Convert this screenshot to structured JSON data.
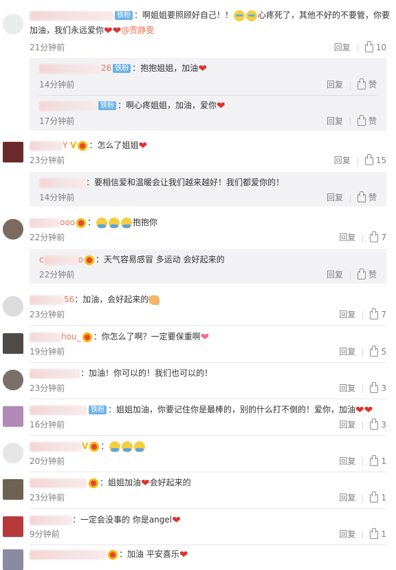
{
  "labels": {
    "reply": "回复",
    "like": "赞",
    "separator": "："
  },
  "comments": [
    {
      "badge": "铁粉",
      "text_a": "啊姐姐要照顾好自己！！",
      "text_b": "心疼死了，其他不好的不要管，你要",
      "text_line2": "加油，我们永远爱你",
      "mention": "@贾静雯",
      "time": "21分钟前",
      "likes": "10",
      "replies": [
        {
          "name_suffix": "26",
          "badge": "铁粉",
          "text": "抱抱姐姐，加油",
          "time": "14分钟前",
          "likes": "赞"
        },
        {
          "badge": "铁粉",
          "text": "啊心疼姐姐，加油，爱你",
          "time": "17分钟前",
          "likes": "赞"
        }
      ]
    },
    {
      "name_suffix": "Y",
      "text": "怎么了姐姐",
      "time": "23分钟前",
      "likes": "15",
      "replies": [
        {
          "text": "要相信爱和温暖会让我们越来越好！我们都爱你的！",
          "time": "14分钟前",
          "likes": "赞"
        }
      ]
    },
    {
      "name_suffix": "ooo",
      "text": "抱抱你",
      "time": "22分钟前",
      "likes": "7",
      "replies": [
        {
          "name_prefix": "c",
          "name_suffix": "o",
          "text": "天气容易感冒 多运动 会好起来的",
          "time": "22分钟前",
          "likes": "赞"
        }
      ]
    },
    {
      "name_suffix": "56",
      "text": "加油，会好起来的",
      "time": "23分钟前",
      "likes": "7"
    },
    {
      "name_suffix": "hou_",
      "text": "你怎么了啊？一定要保重啊",
      "time": "19分钟前",
      "likes": "5"
    },
    {
      "text": "加油！你可以的！我们也可以的！",
      "time": "23分钟前",
      "likes": "3"
    },
    {
      "badge": "铁粉",
      "text": "姐姐加油，你要记住你是最棒的，别的什么打不倒的！爱你，加油",
      "time": "16分钟前",
      "likes": "3"
    },
    {
      "text": "",
      "time": "20分钟前",
      "likes": "1"
    },
    {
      "text_a": "姐姐加油",
      "text_b": "会好起来的",
      "time": "23分钟前",
      "likes": "1"
    },
    {
      "text": "一定会没事的 你是angel",
      "time": "9分钟前",
      "likes": "1"
    },
    {
      "text": "加油 平安喜乐",
      "time": "",
      "likes": ""
    }
  ],
  "colors": {
    "badge": "#6db3e6",
    "heart": "#e0322b",
    "mention": "#eb7350",
    "reply_bg": "#f2f2f5"
  }
}
